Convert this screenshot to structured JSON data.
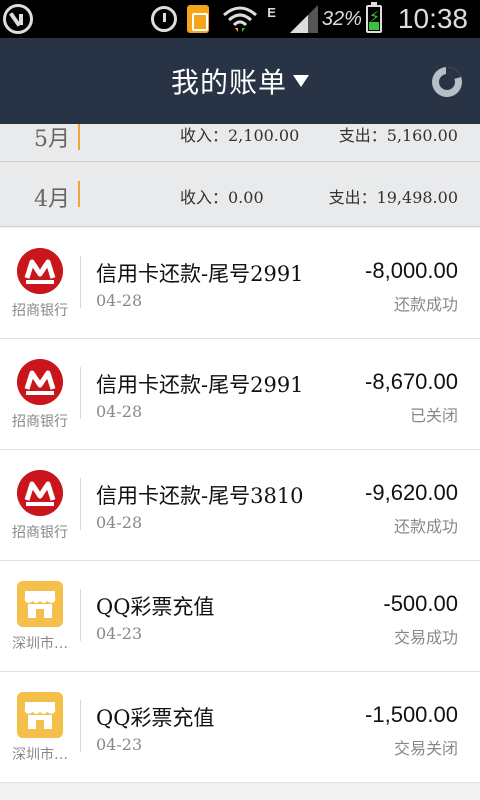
{
  "status_bar": {
    "network_type": "E",
    "battery_percent": "32%",
    "time": "10:38",
    "icons": [
      "usb-debug-icon",
      "alarm-icon",
      "sim-card-icon",
      "wifi-icon",
      "signal-icon",
      "battery-charging-icon"
    ]
  },
  "header": {
    "title": "我的账单",
    "title_icon": "caret-down-icon",
    "action_icon": "pie-chart-icon"
  },
  "months": [
    {
      "label": "5月",
      "income": "收入：2,100.00",
      "expense": "支出：5,160.00"
    },
    {
      "label": "4月",
      "income": "收入：0.00",
      "expense": "支出：19,498.00"
    }
  ],
  "bills": [
    {
      "merchant": "招商银行",
      "logo": "cmb-bank-logo",
      "title": "信用卡还款-尾号2991",
      "date": "04-28",
      "amount": "-8,000.00",
      "status": "还款成功"
    },
    {
      "merchant": "招商银行",
      "logo": "cmb-bank-logo",
      "title": "信用卡还款-尾号2991",
      "date": "04-28",
      "amount": "-8,670.00",
      "status": "已关闭"
    },
    {
      "merchant": "招商银行",
      "logo": "cmb-bank-logo",
      "title": "信用卡还款-尾号3810",
      "date": "04-28",
      "amount": "-9,620.00",
      "status": "还款成功"
    },
    {
      "merchant": "深圳市…",
      "logo": "shop-icon",
      "title": "QQ彩票充值",
      "date": "04-23",
      "amount": "-500.00",
      "status": "交易成功"
    },
    {
      "merchant": "深圳市…",
      "logo": "shop-icon",
      "title": "QQ彩票充值",
      "date": "04-23",
      "amount": "-1,500.00",
      "status": "交易关闭"
    }
  ],
  "colors": {
    "header_bg": "#283445",
    "month_bar_accent": "#f0a33a",
    "cmb_red": "#c9161d",
    "shop_yellow": "#f4c049"
  }
}
